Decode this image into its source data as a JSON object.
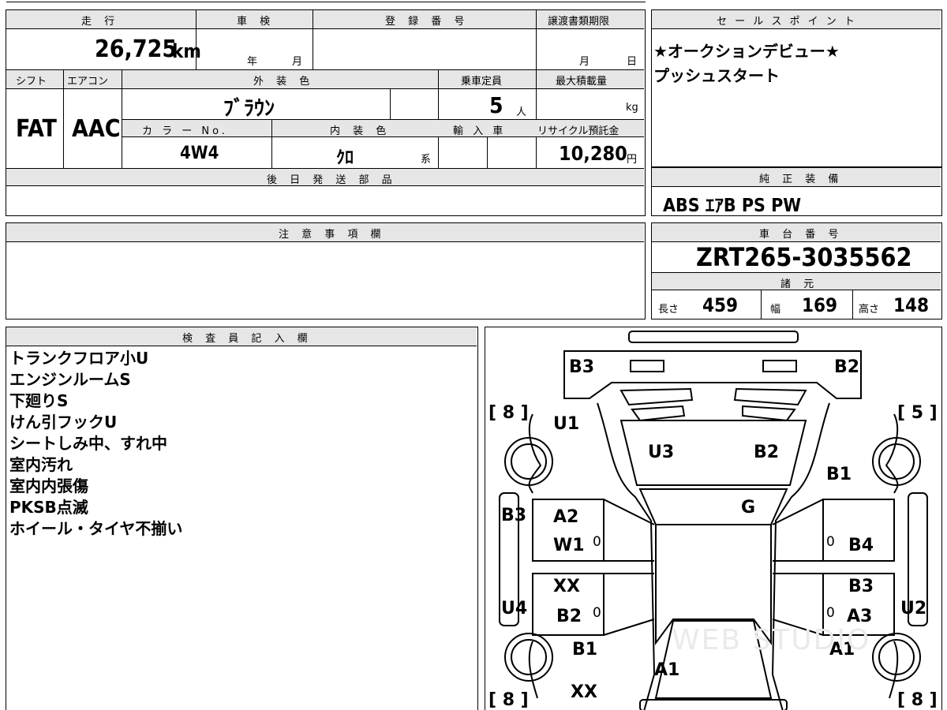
{
  "header": {
    "mileage_label": "走 行",
    "inspection_label": "車 検",
    "registration_label": "登 録 番 号",
    "transfer_label": "譲渡書類期限",
    "mileage_value": "26,725",
    "mileage_unit": "km",
    "year_label": "年",
    "month_label": "月",
    "day_label": "日"
  },
  "row2": {
    "shift_label": "シフト",
    "ac_label": "エアコン",
    "exterior_label": "外 装 色",
    "capacity_label": "乗車定員",
    "max_load_label": "最大積載量",
    "shift_value": "FAT",
    "ac_value": "AAC",
    "exterior_value": "ﾌﾞﾗｳﾝ",
    "capacity_value": "5",
    "capacity_unit": "人",
    "load_unit": "kg"
  },
  "row3": {
    "color_no_label": "カ ラ ー No.",
    "interior_label": "内 装 色",
    "import_label": "輸 入 車",
    "recycle_label": "リサイクル預託金",
    "color_no_value": "4W4",
    "interior_value": "ｸﾛ",
    "interior_suffix": "系",
    "recycle_value": "10,280",
    "recycle_unit": "円"
  },
  "later_parts_label": "後 日 発 送 部 品",
  "notes_label": "注 意 事 項 欄",
  "sales_points": {
    "label": "セ ー ル ス ポ イ ン ト",
    "lines": [
      "★オークションデビュー★",
      "プッシュスタート"
    ]
  },
  "equipment": {
    "label": "純 正 装 備",
    "value": "ABS ｴｱB PS PW"
  },
  "chassis": {
    "label": "車 台 番 号",
    "value": "ZRT265-3035562"
  },
  "specs": {
    "label": "諸 元",
    "length_label": "長さ",
    "length_value": "459",
    "width_label": "幅",
    "width_value": "169",
    "height_label": "高さ",
    "height_value": "148"
  },
  "inspector": {
    "label": "検 査 員 記 入 欄",
    "lines": [
      "トランクフロア小U",
      "エンジンルームS",
      "下廻りS",
      "けん引フックU",
      "シートしみ中、すれ中",
      "室内汚れ",
      "室内内張傷",
      "PKSB点滅",
      "ホイール・タイヤ不揃い"
    ]
  },
  "diagram": {
    "marks": [
      "B3",
      "B2",
      "U1",
      "U3",
      "B2",
      "B1",
      "G",
      "B3",
      "A2",
      "W1",
      "B4",
      "XX",
      "B3",
      "U4",
      "B2",
      "A3",
      "U2",
      "B1",
      "A1",
      "A1",
      "XX"
    ],
    "tires": [
      "[ 8 ]",
      "[ 5 ]",
      "[ 8 ]",
      "[ 8 ]"
    ],
    "zeros": [
      "0",
      "0",
      "0",
      "0"
    ],
    "watermark": "WEB STUDIO"
  }
}
